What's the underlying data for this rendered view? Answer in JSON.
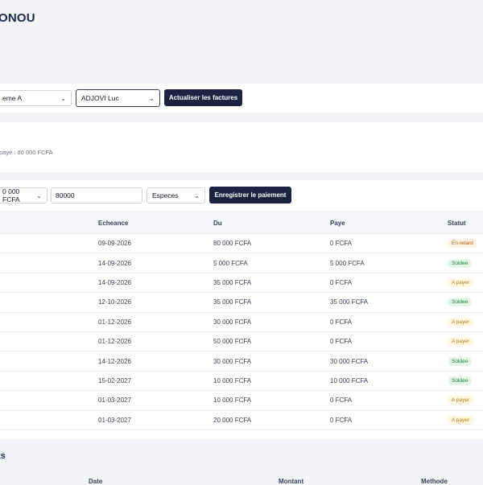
{
  "page": {
    "title": "ONOU"
  },
  "filters": {
    "class_select": "eme A",
    "student_select": "ADJOVI Luc",
    "refresh_button": "Actualiser les factures"
  },
  "summary": {
    "remaining_text": "paye : 80 000 FCFA"
  },
  "payment_form": {
    "invoice_select": "0 000 FCFA",
    "amount_value": "80000",
    "method_select": "Especes",
    "submit_button": "Enregistrer le paiement"
  },
  "invoices": {
    "headers": [
      "Echeance",
      "Du",
      "Paye",
      "Statut"
    ],
    "rows": [
      {
        "due": "09-09-2026",
        "amount": "80 000 FCFA",
        "paid": "0 FCFA",
        "status": "En retard",
        "kind": "late"
      },
      {
        "due": "14-09-2026",
        "amount": "5 000 FCFA",
        "paid": "5 000 FCFA",
        "status": "Soldee",
        "kind": "done"
      },
      {
        "due": "14-09-2026",
        "amount": "35 000 FCFA",
        "paid": "0 FCFA",
        "status": "A payer",
        "kind": "todo"
      },
      {
        "due": "12-10-2026",
        "amount": "35 000 FCFA",
        "paid": "35 000 FCFA",
        "status": "Soldee",
        "kind": "done"
      },
      {
        "due": "01-12-2026",
        "amount": "30 000 FCFA",
        "paid": "0 FCFA",
        "status": "A payer",
        "kind": "todo"
      },
      {
        "due": "01-12-2026",
        "amount": "50 000 FCFA",
        "paid": "0 FCFA",
        "status": "A payer",
        "kind": "todo"
      },
      {
        "due": "14-12-2026",
        "amount": "30 000 FCFA",
        "paid": "30 000 FCFA",
        "status": "Soldee",
        "kind": "done"
      },
      {
        "due": "15-02-2027",
        "amount": "10 000 FCFA",
        "paid": "10 000 FCFA",
        "status": "Soldee",
        "kind": "done"
      },
      {
        "due": "01-03-2027",
        "amount": "10 000 FCFA",
        "paid": "0 FCFA",
        "status": "A payer",
        "kind": "todo"
      },
      {
        "due": "01-03-2027",
        "amount": "20 000 FCFA",
        "paid": "0 FCFA",
        "status": "A payer",
        "kind": "todo"
      }
    ]
  },
  "payments": {
    "title": "ts",
    "headers": [
      "Date",
      "Montant",
      "Methode"
    ]
  }
}
